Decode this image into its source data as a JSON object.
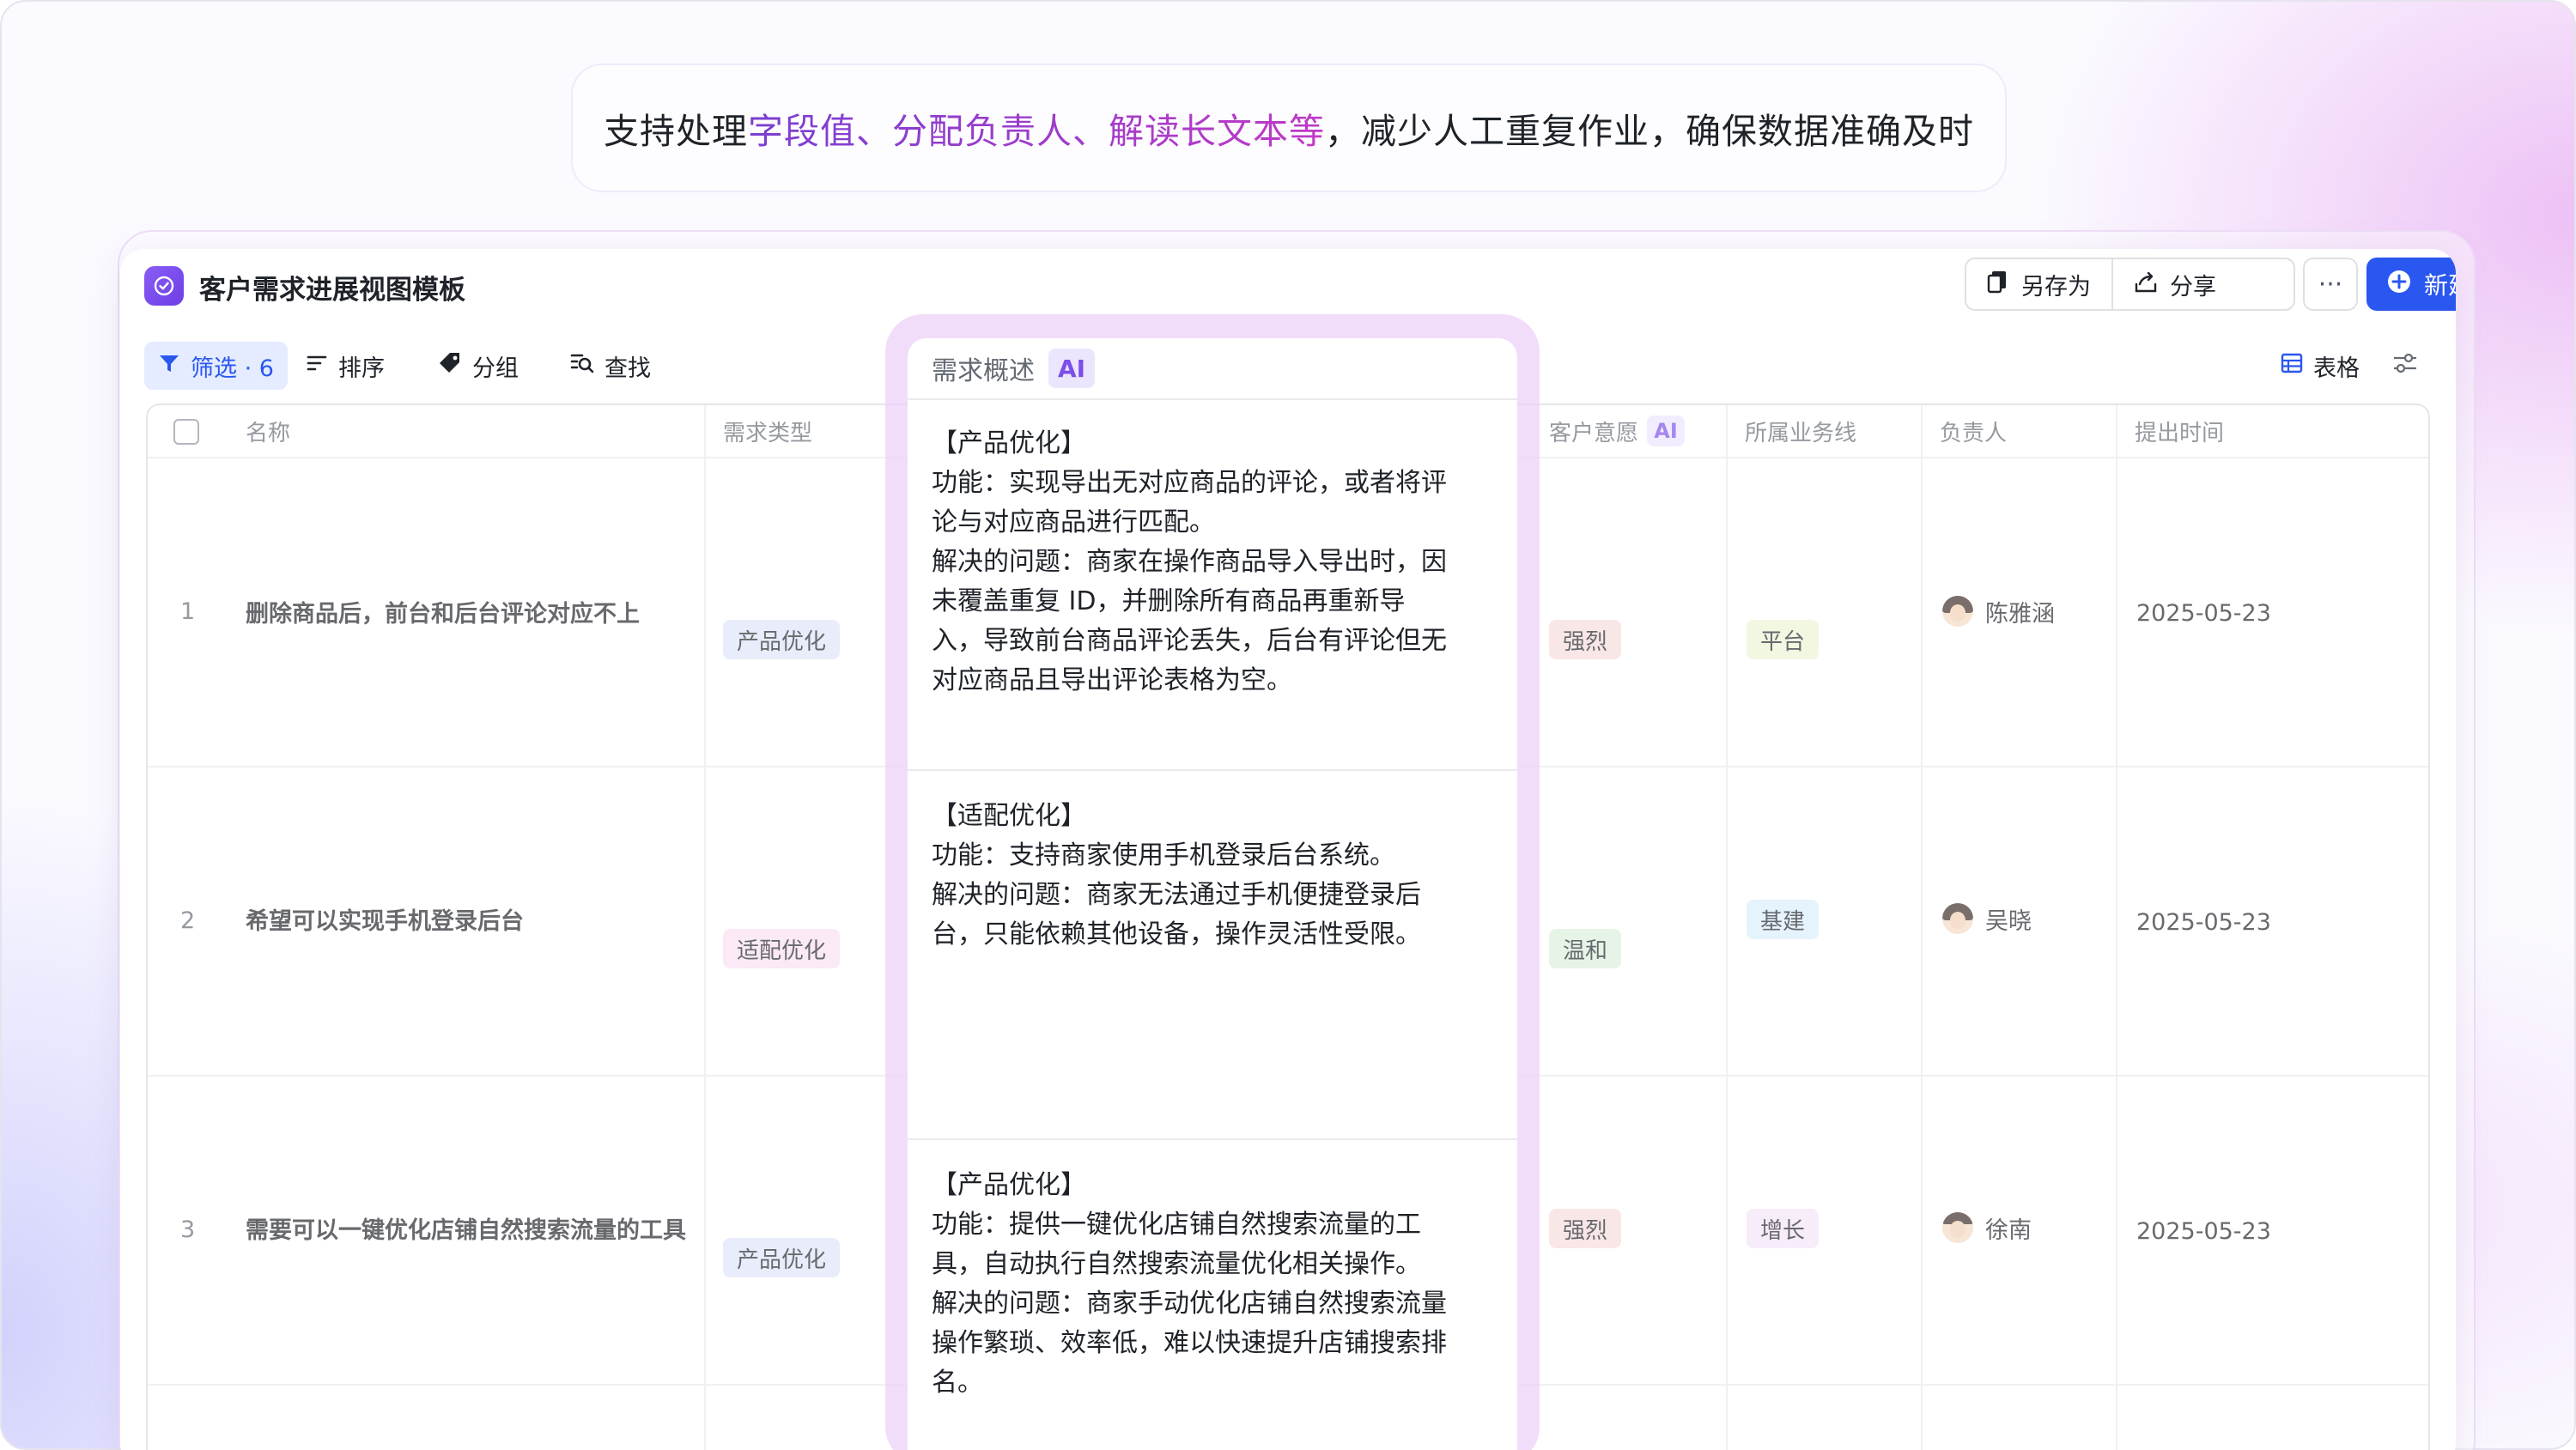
{
  "headline": {
    "part1": "支持处理",
    "part2": "字段值、分配负责人、解读长文本等",
    "part3": "，减少人工重复作业，确保数据准确及时"
  },
  "window": {
    "title": "客户需求进展视图模板",
    "save_as_label": "另存为",
    "share_label": "分享",
    "more_label": "···",
    "new_label": "新建"
  },
  "toolbar": {
    "filter_label": "筛选 · 6",
    "sort_label": "排序",
    "group_label": "分组",
    "find_label": "查找",
    "view_label": "表格"
  },
  "columns": {
    "name": "名称",
    "type": "需求类型",
    "summary": "需求概述",
    "summary_ai": "AI",
    "intent": "客户意愿",
    "intent_ai": "AI",
    "business": "所属业务线",
    "owner": "负责人",
    "date": "提出时间"
  },
  "rows": [
    {
      "num": "1",
      "name": "删除商品后，前台和后台评论对应不上",
      "type": "产品优化",
      "summary": "【产品优化】\n功能：实现导出无对应商品的评论，或者将评\n论与对应商品进行匹配。\n解决的问题：商家在操作商品导入导出时，因\n未覆盖重复 ID，并删除所有商品再重新导\n入，导致前台商品评论丢失，后台有评论但无\n对应商品且导出评论表格为空。",
      "intent": "强烈",
      "business": "平台",
      "owner": "陈雅涵",
      "date": "2025-05-23"
    },
    {
      "num": "2",
      "name": "希望可以实现手机登录后台",
      "type": "适配优化",
      "summary": "【适配优化】\n功能：支持商家使用手机登录后台系统。\n解决的问题：商家无法通过手机便捷登录后\n台，只能依赖其他设备，操作灵活性受限。",
      "intent": "温和",
      "business": "基建",
      "owner": "吴晓",
      "date": "2025-05-23"
    },
    {
      "num": "3",
      "name": "需要可以一键优化店铺自然搜索流量的工具",
      "type": "产品优化",
      "summary": "【产品优化】\n功能：提供一键优化店铺自然搜索流量的工\n具，自动执行自然搜索流量优化相关操作。\n解决的问题：商家手动优化店铺自然搜索流量\n操作繁琐、效率低，难以快速提升店铺搜索排\n名。",
      "intent": "强烈",
      "business": "增长",
      "owner": "徐南",
      "date": "2025-05-23"
    }
  ],
  "colors": {
    "accent": "#2a57f0",
    "ai_purple": "#7b4fe9",
    "tag_product": "#dfe3f8",
    "tag_adapt": "#f9dff2",
    "tag_strong": "#f6dcdc",
    "tag_mild": "#d9efdc",
    "tag_platform": "#eaf3d3",
    "tag_infra": "#d7eefb",
    "tag_growth": "#f3e3f6"
  }
}
